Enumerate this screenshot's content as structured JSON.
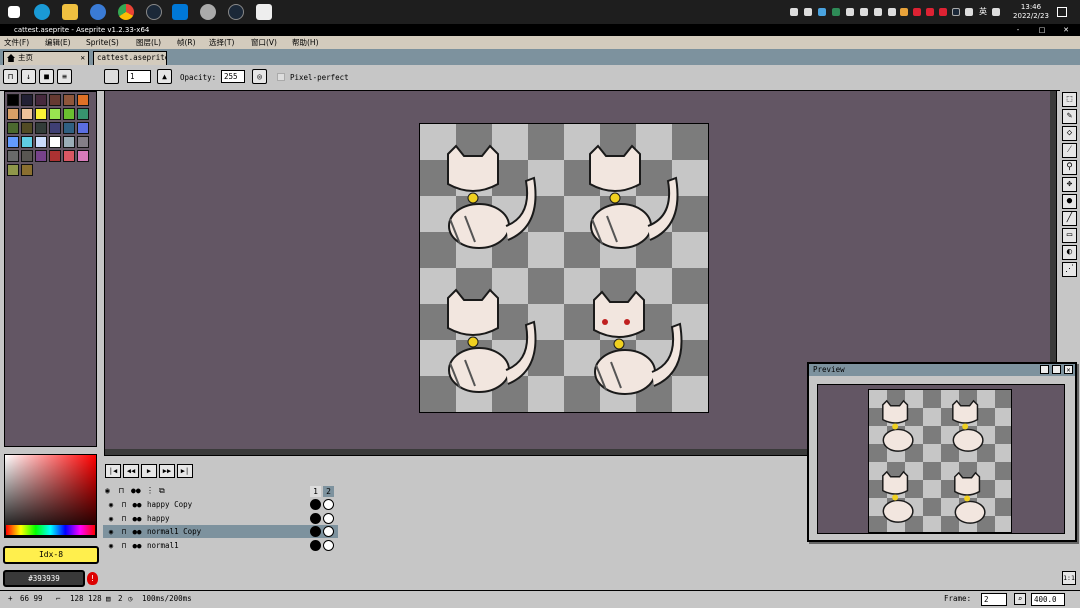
{
  "taskbar": {
    "icons": [
      "windows-start-icon",
      "edge-icon",
      "file-explorer-icon",
      "app-icon",
      "chrome-icon",
      "steam-icon",
      "vscode-icon",
      "settings-icon",
      "steam-icon",
      "app-icon"
    ],
    "time": "13:46",
    "date": "2022/2/23",
    "lang": "英"
  },
  "window": {
    "title": "cattest.aseprite - Aseprite v1.2.33-x64",
    "minimize": "-",
    "maximize": "□",
    "close": "✕"
  },
  "menu": [
    "文件(F)",
    "编辑(E)",
    "Sprite(S)",
    "图层(L)",
    "帧(R)",
    "选择(T)",
    "窗口(V)",
    "帮助(H)"
  ],
  "tabs": {
    "home": "主页",
    "home_close": "✕",
    "file": "cattest.aseprite"
  },
  "toolbar": {
    "brush_size": "1",
    "opacity_label": "Opacity:",
    "opacity_value": "255",
    "pixel_perfect": "Pixel-perfect"
  },
  "palette": {
    "colors": [
      "#000000",
      "#222034",
      "#45283c",
      "#663931",
      "#8f563b",
      "#df7126",
      "#d9a066",
      "#eec39a",
      "#fbf236",
      "#99e550",
      "#6abe30",
      "#37946e",
      "#4b692f",
      "#524b24",
      "#323c39",
      "#3f3f74",
      "#306082",
      "#5b6ee1",
      "#639bff",
      "#5fcde4",
      "#cbdbfc",
      "#ffffff",
      "#9badb7",
      "#847e87",
      "#696a6a",
      "#595652",
      "#76428a",
      "#ac3232",
      "#d95763",
      "#d77bba",
      "#8f974a",
      "#8a6f30"
    ]
  },
  "color": {
    "index_label": "Idx-8",
    "hex": "#393939",
    "fg_color": "#ffef4d"
  },
  "timeline": {
    "frames": [
      "1",
      "2"
    ],
    "layers": [
      {
        "name": "happy Copy",
        "selected": false
      },
      {
        "name": "happy",
        "selected": false
      },
      {
        "name": "normal1 Copy",
        "selected": true
      },
      {
        "name": "normal1",
        "selected": false
      }
    ]
  },
  "preview": {
    "title": "Preview"
  },
  "status": {
    "cursor": "66 99",
    "size": "128 128",
    "frame_count": "2",
    "duration": "100ms/200ms",
    "frame_label": "Frame:",
    "frame_value": "2",
    "zoom": "400.0",
    "zoom_fit": "1:1"
  }
}
